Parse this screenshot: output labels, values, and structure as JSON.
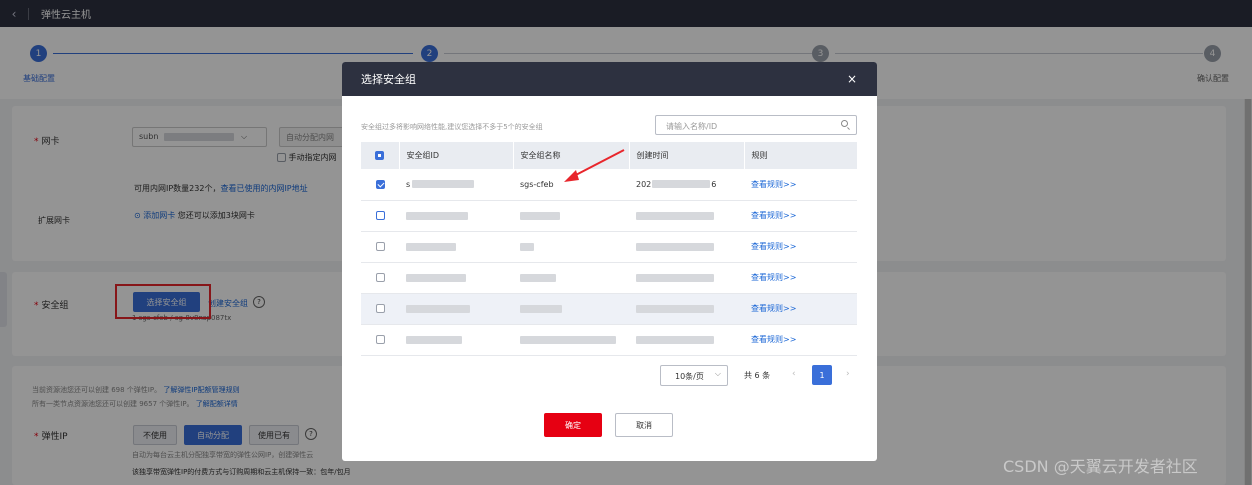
{
  "topbar": {
    "back_icon": "‹",
    "title": "弹性云主机"
  },
  "steps": [
    {
      "number": "1",
      "label": "基础配置",
      "active": true
    },
    {
      "number": "2",
      "label": "",
      "active": true
    },
    {
      "number": "3",
      "label": "",
      "active": false
    },
    {
      "number": "4",
      "label": "确认配置",
      "active": false
    }
  ],
  "bg": {
    "nic_label": "网卡",
    "subnet_value": "subn",
    "auto_ip_label": "自动分配内网",
    "manual_ip_label": "手动指定内网",
    "ip_available_text": "可用内网IP数量232个，",
    "ip_used_link": "查看已使用的内网IP地址",
    "ext_nic_label": "扩展网卡",
    "add_nic_link": "添加网卡",
    "add_nic_hint": "您还可以添加3块网卡",
    "sg_label": "安全组",
    "select_sg_button": "选择安全组",
    "create_sg_link": "创建安全组",
    "sg_selected_text": "1 sgs-cfeb / sg-8v8nsp087tx",
    "eip_quota_line1": "当前资源池您还可以创建 698 个弹性IP。",
    "eip_quota_link1": "了解弹性IP配额管理规则",
    "eip_quota_line2": "所有一类节点资源池您还可以创建 9657 个弹性IP。",
    "eip_quota_link2": "了解配额详情",
    "eip_label": "弹性IP",
    "eip_opt_none": "不使用",
    "eip_opt_auto": "自动分配",
    "eip_opt_existing": "使用已有",
    "eip_auto_hint": "自动为每台云主机分配独享带宽的弹性公网IP，创建弹性云",
    "eip_billing_text": "该独享带宽弹性IP的付费方式与订购周期和云主机保持一致：包年/包月"
  },
  "modal": {
    "title": "选择安全组",
    "close_icon": "×",
    "hint": "安全组过多将影响网络性能,建议您选择不多于5个的安全组",
    "search_placeholder": "请输入名称/ID",
    "columns": [
      "安全组ID",
      "安全组名称",
      "创建时间",
      "规则"
    ],
    "rows": [
      {
        "checked": true,
        "id": "s",
        "name": "sgs-cfeb",
        "time_prefix": "202",
        "time_suffix": "6",
        "rule": "查看规则>>"
      },
      {
        "checked": false,
        "id": "",
        "name": "",
        "time_prefix": "",
        "time_suffix": "",
        "rule": "查看规则>>"
      },
      {
        "checked": false,
        "id": "",
        "name": "",
        "time_prefix": "",
        "time_suffix": "",
        "rule": "查看规则>>"
      },
      {
        "checked": false,
        "id": "",
        "name": "",
        "time_prefix": "",
        "time_suffix": "",
        "rule": "查看规则>>"
      },
      {
        "checked": false,
        "id": "",
        "name": "",
        "time_prefix": "",
        "time_suffix": "",
        "rule": "查看规则>>"
      },
      {
        "checked": false,
        "id": "",
        "name": "",
        "time_prefix": "",
        "time_suffix": "",
        "rule": "查看规则>>"
      }
    ],
    "page_size": "10条/页",
    "total": "共 6 条",
    "current_page": "1",
    "ok_button": "确定",
    "cancel_button": "取消"
  },
  "watermark": "CSDN @天翼云开发者社区",
  "colors": {
    "topbar": "#2d3140",
    "primary": "#3a6fd9",
    "danger": "#e60012",
    "annotation": "#e8262c"
  }
}
